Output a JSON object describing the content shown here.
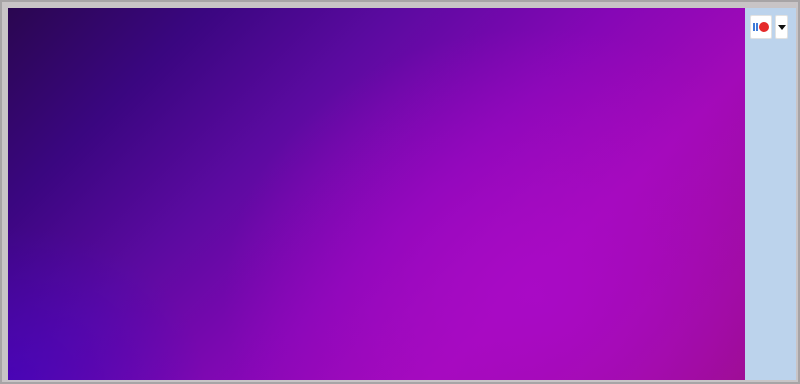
{
  "window": {
    "title": ""
  },
  "canvas": {
    "gradient_colors": [
      "#2a0650",
      "#3a0680",
      "#8607b6",
      "#a30ab8",
      "#9b0e86"
    ]
  },
  "side_panel": {
    "background": "#bcd3ec",
    "extension_button": {
      "icon": "record-extension-icon",
      "colors": [
        "#3f7bd8",
        "#e52a2a"
      ]
    },
    "dropdown_button": {
      "icon": "caret-down-icon"
    }
  }
}
